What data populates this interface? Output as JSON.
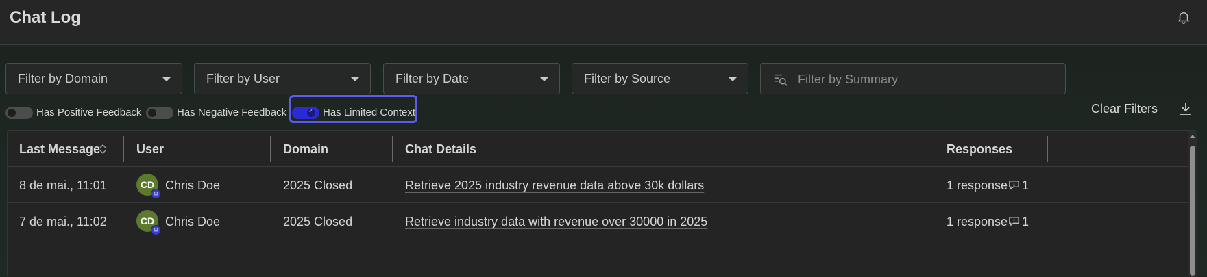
{
  "header": {
    "title": "Chat Log",
    "bell_icon": "bell-icon"
  },
  "filters": {
    "domain_placeholder": "Filter by Domain",
    "user_placeholder": "Filter by User",
    "date_placeholder": "Filter by Date",
    "source_placeholder": "Filter by Source",
    "summary_placeholder": "Filter by Summary"
  },
  "toggles": [
    {
      "label": "Has Positive Feedback",
      "on": false
    },
    {
      "label": "Has Negative Feedback",
      "on": false
    },
    {
      "label": "Has Limited Context",
      "on": true
    }
  ],
  "actions": {
    "clear_filters": "Clear Filters",
    "download_icon": "download-icon"
  },
  "colors": {
    "accent": "#2b2bd6",
    "focus": "#5b5bf0",
    "avatar": "#5b7a2e"
  },
  "table": {
    "columns": [
      "Last Message",
      "User",
      "Domain",
      "Chat Details",
      "Responses"
    ],
    "rows": [
      {
        "last_message": "8 de mai., 11:01",
        "avatar_initials": "CD",
        "user": "Chris Doe",
        "domain": "2025 Closed",
        "chat_details": "Retrieve 2025 industry revenue data above 30k dollars",
        "responses": "1 response",
        "comment_count": "1"
      },
      {
        "last_message": "7 de mai., 11:02",
        "avatar_initials": "CD",
        "user": "Chris Doe",
        "domain": "2025 Closed",
        "chat_details": "Retrieve industry data with revenue over 30000 in 2025",
        "responses": "1 response",
        "comment_count": "1"
      }
    ]
  }
}
